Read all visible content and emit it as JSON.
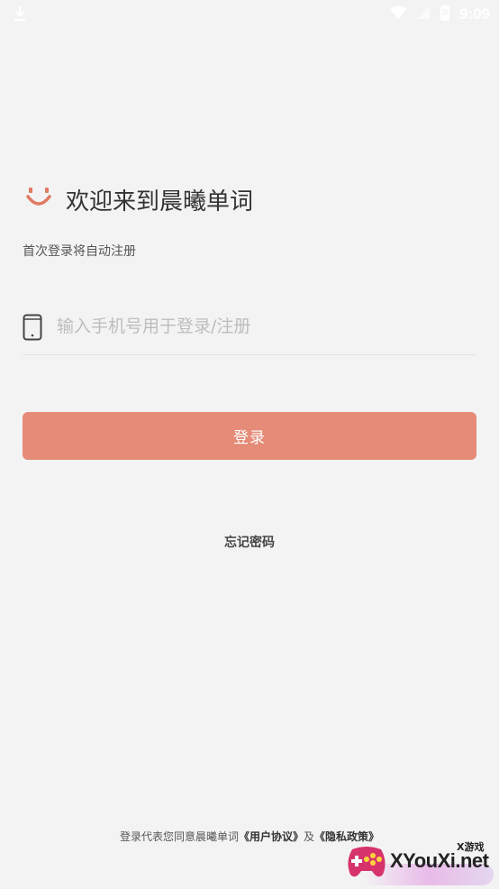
{
  "status_bar": {
    "time": "9:09",
    "icons": [
      "download-icon",
      "wifi-icon",
      "signal-icon",
      "battery-icon"
    ]
  },
  "login": {
    "logo_icon": "smile-logo-icon",
    "welcome_title": "欢迎来到晨曦单词",
    "hint": "首次登录将自动注册",
    "phone_input": {
      "placeholder": "输入手机号用于登录/注册",
      "value": ""
    },
    "login_button": "登录",
    "forgot_password": "忘记密码"
  },
  "agreement": {
    "prefix": "登录代表您同意晨曦单词",
    "user_agreement": "《用户协议》",
    "and": "及",
    "privacy_policy": "《隐私政策》"
  },
  "watermark": {
    "text": "XYouXi.net",
    "tag": "X游戏"
  },
  "colors": {
    "background": "#f3f3f3",
    "accent": "#e58b77",
    "logo": "#e07a62"
  }
}
